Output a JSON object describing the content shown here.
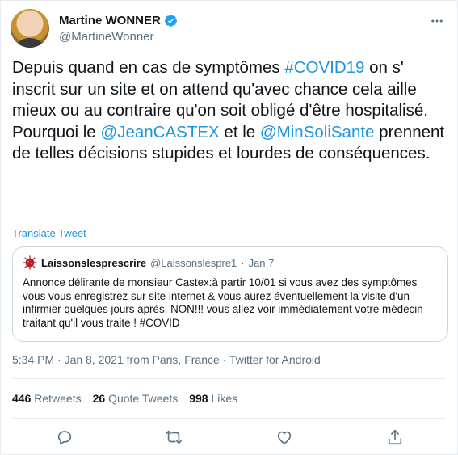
{
  "author": {
    "display_name": "Martine WONNER",
    "handle": "@MartineWonner"
  },
  "tweet": {
    "line1_a": "Depuis quand en cas de symptômes ",
    "hashtag": "#COVID19",
    "line1_b": " on s' inscrit sur un site et on attend qu'avec chance cela aille mieux ou au contraire qu'on soit obligé d'être hospitalisé.",
    "line2_a": "Pourquoi le ",
    "mention1": "@JeanCASTEX",
    "line2_b": " et le ",
    "mention2": "@MinSoliSante",
    "line2_c": " prennent de telles décisions stupides et lourdes de conséquences.",
    "translate_label": "Translate Tweet"
  },
  "quote": {
    "name": "Laissonslesprescrire",
    "handle": "@Laissonslespre1",
    "separator": "·",
    "date": "Jan 7",
    "text": "Annonce délirante de monsieur Castex:à partir 10/01 si vous avez des symptômes vous vous enregistrez sur site internet & vous aurez éventuellement la visite d'un infirmier quelques jours après. NON!!! vous allez voir immédiatement votre médecin traitant qu'il vous traite ! #COVID"
  },
  "meta": "5:34 PM · Jan 8, 2021 from Paris, France · Twitter for Android",
  "stats": {
    "retweets_count": "446",
    "retweets_label": "Retweets",
    "quotes_count": "26",
    "quotes_label": "Quote Tweets",
    "likes_count": "998",
    "likes_label": "Likes"
  },
  "colors": {
    "link": "#1b95e0",
    "secondary_text": "#5b7083",
    "border": "#e6ecf0"
  },
  "icons": {
    "verified": "verified-badge-icon",
    "more": "more-dots-icon",
    "reply": "reply-icon",
    "retweet": "retweet-icon",
    "like": "like-icon",
    "share": "share-icon"
  }
}
